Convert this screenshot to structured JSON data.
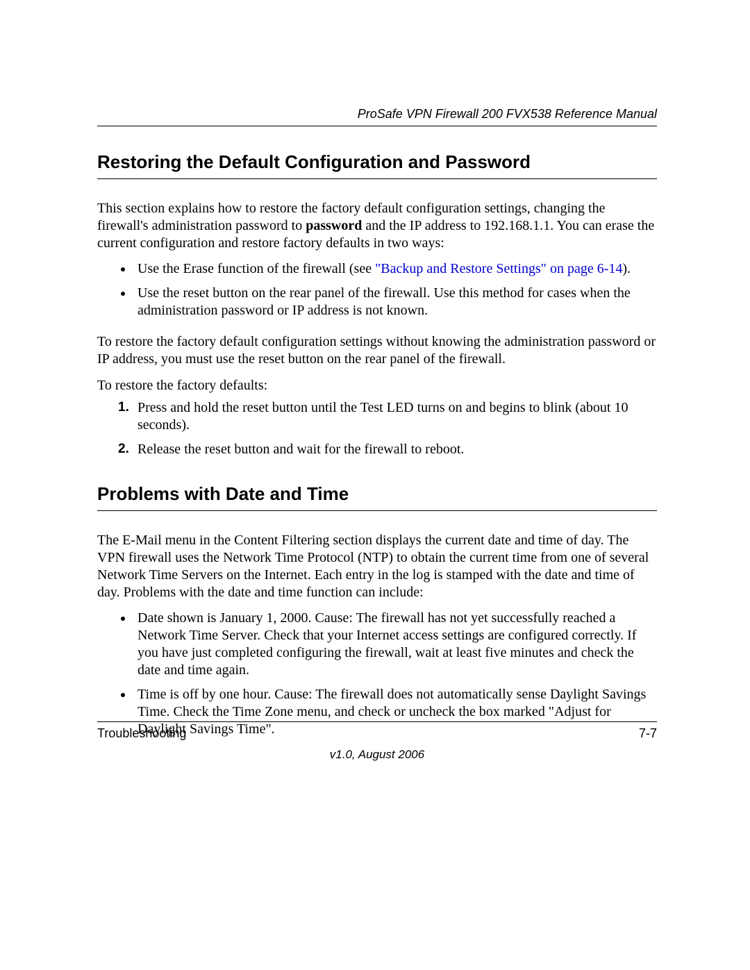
{
  "header": {
    "manual_title": "ProSafe VPN Firewall 200 FVX538 Reference Manual"
  },
  "section1": {
    "heading": "Restoring the Default Configuration and Password",
    "intro_before_bold": "This section explains how to restore the factory default configuration settings, changing the firewall's administration password to ",
    "bold_word": "password",
    "intro_after_bold": " and the IP address to 192.168.1.1. You can erase the current configuration and restore factory defaults in two ways:",
    "bullet1_before_link": "Use the Erase function of the firewall (see ",
    "bullet1_link": "\"Backup and Restore Settings\" on page 6-14",
    "bullet1_after_link": ").",
    "bullet2": "Use the reset button on the rear panel of the firewall. Use this method for cases when the administration password or IP address is not known.",
    "para2": "To restore the factory default configuration settings without knowing the administration password or IP address, you must use the reset button on the rear panel of the firewall.",
    "leadin": "To restore the factory defaults:",
    "step1": "Press and hold the reset button until the Test LED turns on and begins to blink (about 10 seconds).",
    "step2": "Release the reset button and wait for the firewall to reboot."
  },
  "section2": {
    "heading": "Problems with Date and Time",
    "para1": "The E-Mail menu in the Content Filtering section displays the current date and time of day. The VPN firewall uses the Network Time Protocol (NTP) to obtain the current time from one of several Network Time Servers on the Internet. Each entry in the log is stamped with the date and time of day. Problems with the date and time function can include:",
    "bullet1": "Date shown is January 1, 2000. Cause: The firewall has not yet successfully reached a Network Time Server. Check that your Internet access settings are configured correctly. If you have just completed configuring the firewall, wait at least five minutes and check the date and time again.",
    "bullet2": "Time is off by one hour. Cause: The firewall does not automatically sense Daylight Savings Time. Check the Time Zone menu, and check or uncheck the box marked \"Adjust for Daylight Savings Time\"."
  },
  "footer": {
    "chapter": "Troubleshooting",
    "page_num": "7-7",
    "version": "v1.0, August 2006"
  }
}
